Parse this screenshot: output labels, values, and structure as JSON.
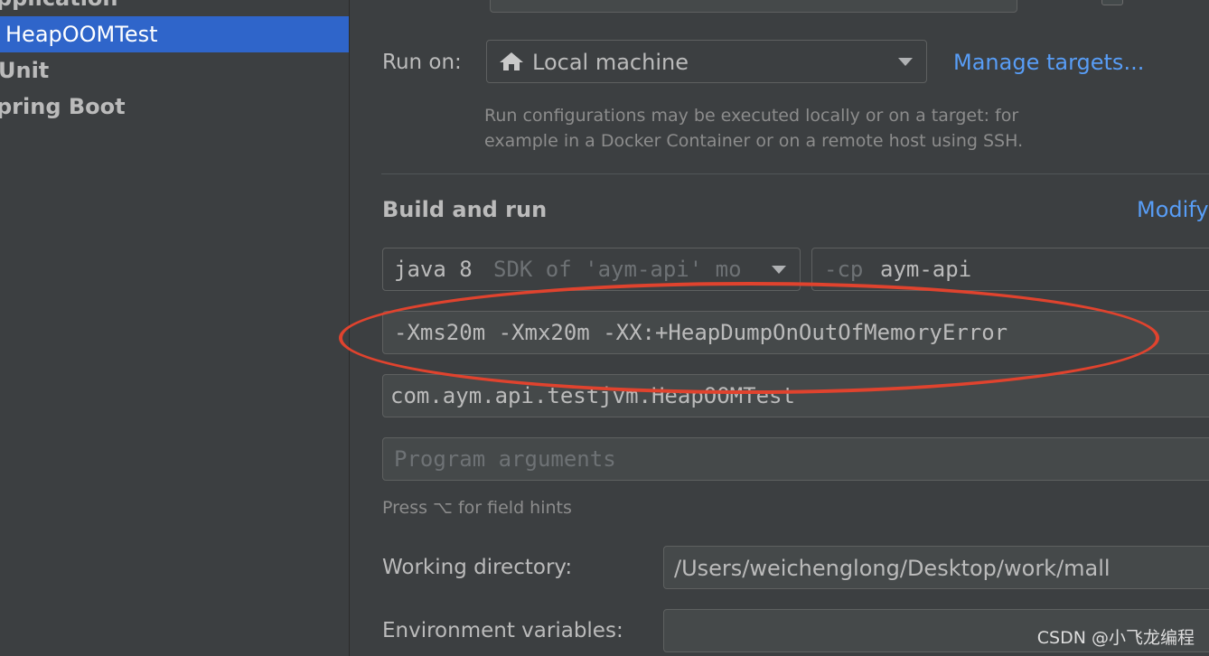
{
  "sidebar": {
    "items": [
      {
        "label": "pplication"
      },
      {
        "label": "HeapOOMTest"
      },
      {
        "label": "Unit"
      },
      {
        "label": "pring Boot"
      }
    ]
  },
  "run_on": {
    "label": "Run on:",
    "value": "Local machine",
    "icon": "home-icon",
    "manage_link": "Manage targets...",
    "hint_line1": "Run configurations may be executed locally or on a target: for",
    "hint_line2": "example in a Docker Container or on a remote host using SSH."
  },
  "build": {
    "title": "Build and run",
    "modify_link": "Modify",
    "jdk_value": "java 8",
    "jdk_hint": "SDK of 'aym-api' mo",
    "cp_flag": "-cp",
    "cp_value": "aym-api",
    "vm_options": "-Xms20m -Xmx20m -XX:+HeapDumpOnOutOfMemoryError",
    "main_class": "com.aym.api.testjvm.HeapOOMTest",
    "program_args_placeholder": "Program arguments",
    "field_hint": "Press ⌥ for field hints",
    "working_dir_label": "Working directory:",
    "working_dir_value": "/Users/weichenglong/Desktop/work/mall",
    "env_label": "Environment variables:"
  },
  "watermark": "CSDN @小飞龙编程",
  "colors": {
    "background": "#3c3f41",
    "selection": "#2f65ca",
    "link": "#589df6",
    "annotation": "#e0432e"
  }
}
